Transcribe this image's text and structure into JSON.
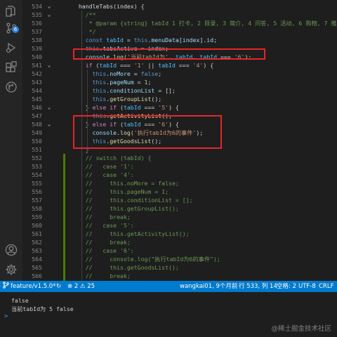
{
  "activity_bar": {
    "icons": [
      "files-icon",
      "source-control-icon",
      "run-debug-icon",
      "extensions-icon",
      "git-graph-icon",
      "account-icon",
      "settings-gear-icon"
    ],
    "source_control_badge": "6"
  },
  "editor": {
    "lines": [
      {
        "n": "534",
        "segs": [
          [
            "p",
            "  handleTabs(index) {"
          ]
        ]
      },
      {
        "n": "535",
        "segs": [
          [
            "cmt",
            "    /**"
          ]
        ]
      },
      {
        "n": "536",
        "segs": [
          [
            "cmt",
            "     * @param {string} tabId 1 打卡, 2 目录, 3 简介, 4 问答, 5 活动, 6 购物, 7 推荐"
          ]
        ]
      },
      {
        "n": "537",
        "segs": [
          [
            "cmt",
            "     */"
          ]
        ]
      },
      {
        "n": "538",
        "segs": [
          [
            "kw",
            "    const "
          ],
          [
            "const",
            "tabId"
          ],
          [
            "p",
            " = "
          ],
          [
            "kw",
            "this"
          ],
          [
            "p",
            "."
          ],
          [
            "var",
            "menuData"
          ],
          [
            "p",
            "["
          ],
          [
            "var",
            "index"
          ],
          [
            "p",
            "]."
          ],
          [
            "var",
            "id"
          ],
          [
            "p",
            ";"
          ]
        ]
      },
      {
        "n": "539",
        "segs": [
          [
            "kw",
            "    this"
          ],
          [
            "p",
            "."
          ],
          [
            "var",
            "tabsActive"
          ],
          [
            "p",
            " = "
          ],
          [
            "var",
            "index"
          ],
          [
            "p",
            ";"
          ]
        ]
      },
      {
        "n": "540",
        "segs": [
          [
            "var",
            "    console"
          ],
          [
            "p",
            "."
          ],
          [
            "fn",
            "log"
          ],
          [
            "p",
            "("
          ],
          [
            "str",
            "'当前tabId为'"
          ],
          [
            "p",
            ", "
          ],
          [
            "const",
            "tabId"
          ],
          [
            "p",
            ", "
          ],
          [
            "const",
            "tabId"
          ],
          [
            "p",
            " === "
          ],
          [
            "str",
            "'6'"
          ],
          [
            "p",
            ");"
          ]
        ]
      },
      {
        "n": "541",
        "segs": [
          [
            "ctl",
            "    if"
          ],
          [
            "p",
            " ("
          ],
          [
            "const",
            "tabId"
          ],
          [
            "p",
            " === "
          ],
          [
            "str",
            "'1'"
          ],
          [
            "p",
            " || "
          ],
          [
            "const",
            "tabId"
          ],
          [
            "p",
            " === "
          ],
          [
            "str",
            "'4'"
          ],
          [
            "p",
            ") {"
          ]
        ]
      },
      {
        "n": "542",
        "segs": [
          [
            "kw",
            "      this"
          ],
          [
            "p",
            "."
          ],
          [
            "var",
            "noMore"
          ],
          [
            "p",
            " = "
          ],
          [
            "kw",
            "false"
          ],
          [
            "p",
            ";"
          ]
        ]
      },
      {
        "n": "543",
        "segs": [
          [
            "kw",
            "      this"
          ],
          [
            "p",
            "."
          ],
          [
            "var",
            "pageNum"
          ],
          [
            "p",
            " = "
          ],
          [
            "num",
            "1"
          ],
          [
            "p",
            ";"
          ]
        ]
      },
      {
        "n": "544",
        "segs": [
          [
            "kw",
            "      this"
          ],
          [
            "p",
            "."
          ],
          [
            "var",
            "conditionList"
          ],
          [
            "p",
            " = [];"
          ]
        ]
      },
      {
        "n": "545",
        "segs": [
          [
            "kw",
            "      this"
          ],
          [
            "p",
            "."
          ],
          [
            "fn",
            "getGroupList"
          ],
          [
            "p",
            "();"
          ]
        ]
      },
      {
        "n": "546",
        "segs": [
          [
            "p",
            "    } "
          ],
          [
            "ctl",
            "else if"
          ],
          [
            "p",
            " ("
          ],
          [
            "const",
            "tabId"
          ],
          [
            "p",
            " === "
          ],
          [
            "str",
            "'5'"
          ],
          [
            "p",
            ") {"
          ]
        ]
      },
      {
        "n": "547",
        "segs": [
          [
            "kw",
            "      this"
          ],
          [
            "p",
            "."
          ],
          [
            "fn",
            "getActivityList"
          ],
          [
            "p",
            "();"
          ]
        ]
      },
      {
        "n": "548",
        "segs": [
          [
            "p",
            "    } "
          ],
          [
            "ctl",
            "else if"
          ],
          [
            "p",
            " ("
          ],
          [
            "const",
            "tabId"
          ],
          [
            "p",
            " === "
          ],
          [
            "str",
            "'6'"
          ],
          [
            "p",
            ") {"
          ]
        ]
      },
      {
        "n": "549",
        "segs": [
          [
            "var",
            "      console"
          ],
          [
            "p",
            "."
          ],
          [
            "fn",
            "log"
          ],
          [
            "p",
            "("
          ],
          [
            "str",
            "'执行tabId为6的事件'"
          ],
          [
            "p",
            ");"
          ]
        ]
      },
      {
        "n": "550",
        "segs": [
          [
            "kw",
            "      this"
          ],
          [
            "p",
            "."
          ],
          [
            "fn",
            "getGoodsList"
          ],
          [
            "p",
            "();"
          ]
        ]
      },
      {
        "n": "551",
        "segs": [
          [
            "p",
            "    }"
          ]
        ]
      },
      {
        "n": "552",
        "segs": [
          [
            "cmt",
            "    // switch (tabId) {"
          ]
        ]
      },
      {
        "n": "553",
        "segs": [
          [
            "cmt",
            "    //   case '1':"
          ]
        ]
      },
      {
        "n": "554",
        "segs": [
          [
            "cmt",
            "    //   case '4':"
          ]
        ]
      },
      {
        "n": "555",
        "segs": [
          [
            "cmt",
            "    //     this.noMore = false;"
          ]
        ]
      },
      {
        "n": "556",
        "segs": [
          [
            "cmt",
            "    //     this.pageNum = 1;"
          ]
        ]
      },
      {
        "n": "557",
        "segs": [
          [
            "cmt",
            "    //     this.conditionList = [];"
          ]
        ]
      },
      {
        "n": "558",
        "segs": [
          [
            "cmt",
            "    //     this.getGroupList();"
          ]
        ]
      },
      {
        "n": "559",
        "segs": [
          [
            "cmt",
            "    //     break;"
          ]
        ]
      },
      {
        "n": "560",
        "segs": [
          [
            "cmt",
            "    //   case '5':"
          ]
        ]
      },
      {
        "n": "561",
        "segs": [
          [
            "cmt",
            "    //     this.getActivityList();"
          ]
        ]
      },
      {
        "n": "562",
        "segs": [
          [
            "cmt",
            "    //     break;"
          ]
        ]
      },
      {
        "n": "563",
        "segs": [
          [
            "cmt",
            "    //   case '6':"
          ]
        ]
      },
      {
        "n": "564",
        "segs": [
          [
            "cmt",
            "    //     console.log(\"执行tabId为6的事件\");"
          ]
        ]
      },
      {
        "n": "565",
        "segs": [
          [
            "cmt",
            "    //     this.getGoodsList();"
          ]
        ]
      },
      {
        "n": "566",
        "segs": [
          [
            "cmt",
            "    //     break;"
          ]
        ]
      },
      {
        "n": "567",
        "segs": [
          [
            "cmt",
            "    //   default:"
          ]
        ]
      },
      {
        "n": "568",
        "segs": [
          [
            "cmt",
            "    //     break;"
          ]
        ]
      }
    ]
  },
  "statusbar": {
    "branch": "feature/v1.5.0*",
    "sync_icon": "sync-icon",
    "problems": "⊗ 2 ⚠ 25",
    "errors_icon": "error-icon",
    "blame": "wangkai01, 9个月前",
    "cursor": "行 533, 列 14",
    "indent": "空格: 2",
    "encoding": "UTF-8",
    "eol": "CRLF"
  },
  "terminal": {
    "lines": [
      "false",
      "当前tabId为 5 false"
    ],
    "prompt": ">"
  },
  "watermark": "@稀土掘金技术社区",
  "colors": {
    "statusbar": "#007acc",
    "highlight_box": "#e52626",
    "editor_bg": "#1e1e1e"
  }
}
